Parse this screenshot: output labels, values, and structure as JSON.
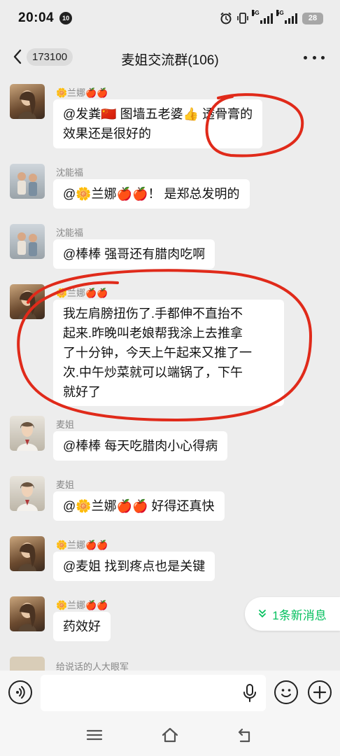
{
  "status": {
    "time": "20:04",
    "notif_badge": "10",
    "sig1": "5G",
    "sig2": "5G",
    "battery": "28"
  },
  "header": {
    "unread_count": "173100",
    "title": "麦姐交流群(106)"
  },
  "messages": [
    {
      "sender": "🌼兰娜🍎🍎",
      "lines": [
        "@发粪🇨🇳 图墙五老婆👍 透骨膏的",
        "效果还是很好的"
      ]
    },
    {
      "sender": "沈能福",
      "lines": [
        "@🌼兰娜🍎🍎！ 是郑总发明的"
      ]
    },
    {
      "sender": "沈能福",
      "lines": [
        "@棒棒  强哥还有腊肉吃啊"
      ]
    },
    {
      "sender": "🌼兰娜🍎🍎",
      "lines": [
        "我左肩膀扭伤了.手都伸不直抬不",
        "起来.昨晚叫老娘帮我涂上去推拿",
        "了十分钟，今天上午起来又推了一",
        "次.中午炒菜就可以端锅了，下午",
        "就好了"
      ]
    },
    {
      "sender": "麦姐",
      "lines": [
        "@棒棒  每天吃腊肉小心得病"
      ]
    },
    {
      "sender": "麦姐",
      "lines": [
        "@🌼兰娜🍎🍎  好得还真快"
      ]
    },
    {
      "sender": "🌼兰娜🍎🍎",
      "lines": [
        "@麦姐  找到疼点也是关键"
      ]
    },
    {
      "sender": "🌼兰娜🍎🍎",
      "lines": [
        "药效好"
      ]
    },
    {
      "sender": "给说话的人大眼军",
      "lines": []
    }
  ],
  "new_messages": "1条新消息",
  "input": {
    "placeholder": ""
  },
  "icons": {
    "back": "chevron-left-icon",
    "more": "more-dots-icon",
    "voice": "voice-icon",
    "mic": "mic-icon",
    "emoji": "emoji-icon",
    "plus": "plus-icon",
    "nav_menu": "menu-icon",
    "nav_home": "home-icon",
    "nav_back": "back-icon"
  },
  "colors": {
    "accent_green": "#07c160",
    "annotation_red": "#e02a1a",
    "background": "#ededed"
  }
}
